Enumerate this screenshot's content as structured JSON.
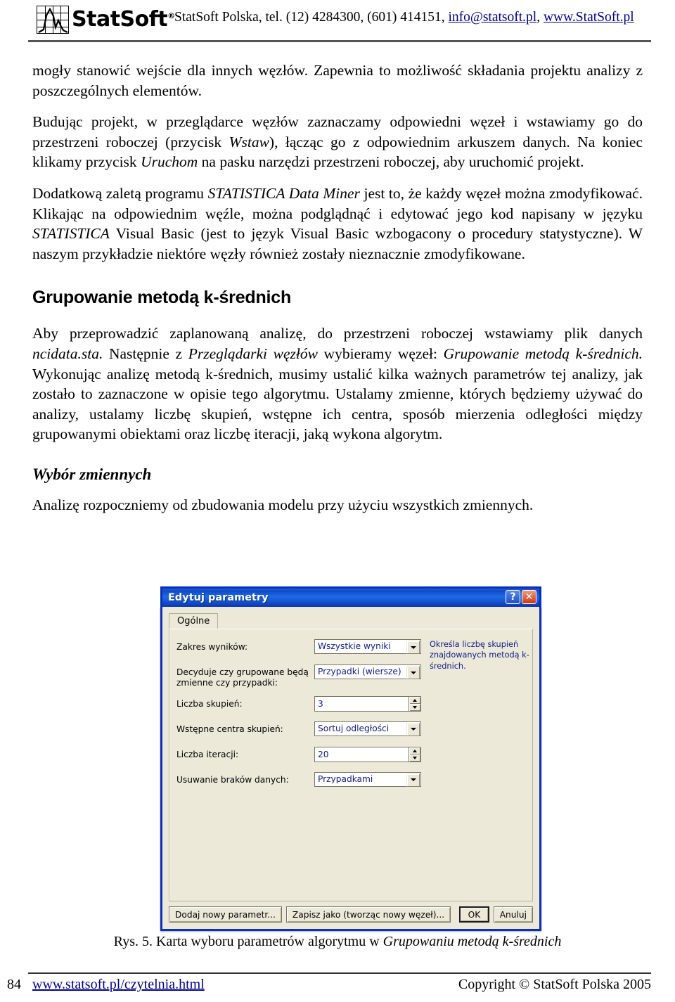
{
  "header": {
    "logo_text": "StatSoft",
    "logo_registered": "®",
    "contact_prefix": "StatSoft Polska, tel. (12) 4284300, (601) 414151, ",
    "email": "info@statsoft.pl",
    "separator": ", ",
    "website": "www.StatSoft.pl"
  },
  "content": {
    "para1_a": "mogły stanowić wejście dla innych węzłów. Zapewnia to możliwość składania projektu analizy z poszczególnych elementów.",
    "para2_a": "Budując projekt, w przeglądarce węzłów zaznaczamy odpowiedni węzeł i wstawiamy go do przestrzeni roboczej (przycisk ",
    "para2_i1": "Wstaw",
    "para2_b": "), łącząc go z odpowiednim arkuszem danych. Na koniec klikamy przycisk ",
    "para2_i2": "Uruchom",
    "para2_c": " na pasku narzędzi przestrzeni roboczej, aby uruchomić projekt.",
    "para3_a": "Dodatkową zaletą programu ",
    "para3_i1": "STATISTICA Data Miner",
    "para3_b": " jest to, że każdy węzeł można zmodyfikować. Klikając na odpowiednim węźle, można podglądnąć i edytować jego kod napisany w języku ",
    "para3_i2": "STATISTICA",
    "para3_c": " Visual Basic (jest to język Visual Basic wzbogacony o procedury statystyczne). W naszym przykładzie niektóre węzły również zostały nieznacznie zmodyfikowane.",
    "heading_kmeans": "Grupowanie metodą k-średnich",
    "para4_a": "Aby przeprowadzić zaplanowaną analizę, do przestrzeni roboczej wstawiamy plik danych ",
    "para4_i1": "ncidata.sta.",
    "para4_b": " Następnie z ",
    "para4_i2": "Przeglądarki węzłów",
    "para4_c": " wybieramy węzeł: ",
    "para4_i3": "Grupowanie metodą k-średnich.",
    "para4_d": " Wykonując analizę metodą k-średnich, musimy ustalić kilka ważnych parametrów tej analizy, jak zostało to zaznaczone w opisie tego algorytmu. Ustalamy zmienne, których będziemy używać do analizy, ustalamy liczbę skupień, wstępne ich centra, sposób mierzenia odległości między grupowanymi obiektami oraz liczbę iteracji, jaką wykona algorytm.",
    "subheading_vars": "Wybór zmiennych",
    "para5_a": "Analizę rozpoczniemy od zbudowania modelu przy użyciu wszystkich zmiennych."
  },
  "dialog": {
    "title": "Edytuj parametry",
    "help_button": "?",
    "close_button": "✕",
    "tab_label": "Ogólne",
    "help_text": "Określa liczbę skupień znajdowanych metodą k-średnich.",
    "fields": [
      {
        "label": "Zakres wyników:",
        "value": "Wszystkie wyniki",
        "type": "combo"
      },
      {
        "label": "Decyduje czy grupowane będą zmienne czy przypadki:",
        "value": "Przypadki (wiersze)",
        "type": "combo"
      },
      {
        "label": "Liczba skupień:",
        "value": "3",
        "type": "spinner"
      },
      {
        "label": "Wstępne centra skupień:",
        "value": "Sortuj odległości",
        "type": "combo"
      },
      {
        "label": "Liczba iteracji:",
        "value": "20",
        "type": "spinner"
      },
      {
        "label": "Usuwanie braków danych:",
        "value": "Przypadkami",
        "type": "combo"
      }
    ],
    "buttons": {
      "add_param": "Dodaj nowy parametr...",
      "save_as": "Zapisz jako (tworząc nowy węzeł)...",
      "ok": "OK",
      "cancel": "Anuluj"
    }
  },
  "caption": {
    "prefix": "Rys. 5. Karta wyboru parametrów algorytmu w ",
    "italic": "Grupowaniu metodą k-średnich"
  },
  "footer": {
    "page_number": "84",
    "url": "www.statsoft.pl/czytelnia.html",
    "copyright": "Copyright © StatSoft Polska 2005"
  },
  "colors": {
    "link": "#00008B",
    "xp_title": "#0A2FB8",
    "dialog_face": "#ECE9D8",
    "combo_text": "#12208A"
  }
}
